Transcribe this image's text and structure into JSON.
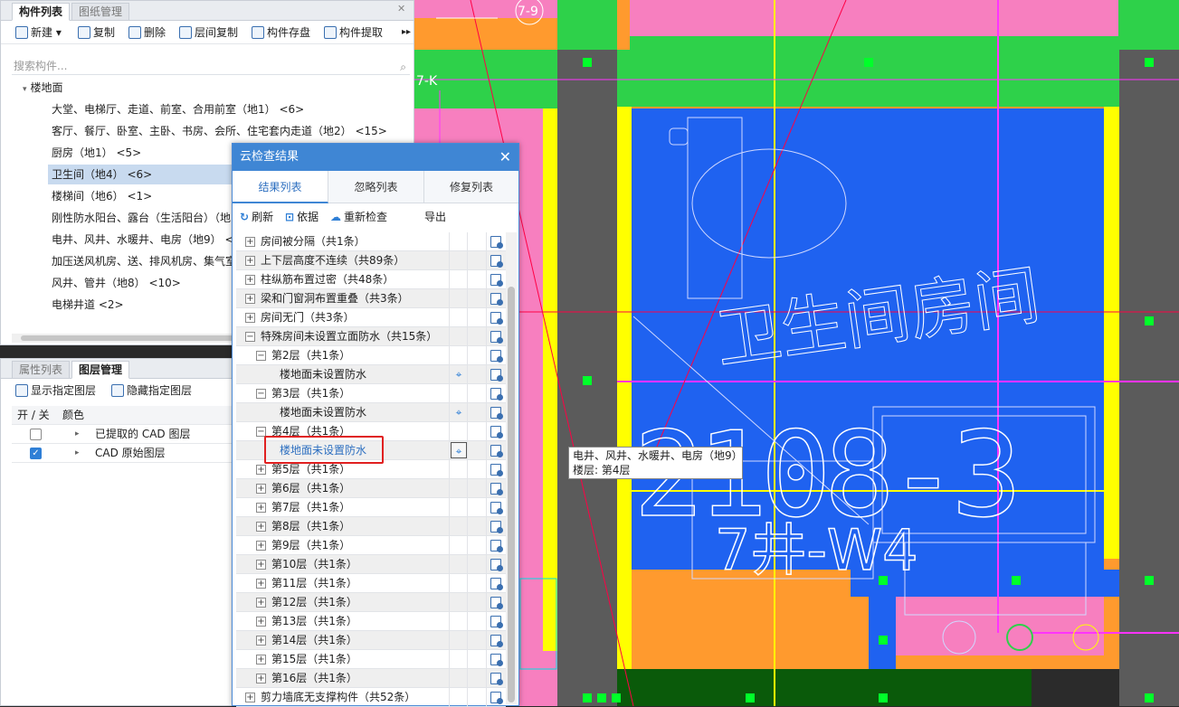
{
  "colors": {
    "pink": "#f77fbf",
    "green": "#2ed14a",
    "blue": "#1f62f0",
    "orange": "#ff9a2e",
    "yellow": "#ffff00",
    "gray": "#5b5b5b",
    "dark_green": "#0a5a0a",
    "magenta": "#ff33ff",
    "accent": "#3f86d4"
  },
  "cad": {
    "labels": {
      "grid_a": "7-9",
      "grid_b": "7-K",
      "room_name": "卫生间房间",
      "code": "2108-3",
      "code2": "7井-W4"
    }
  },
  "component_panel": {
    "tabs": [
      "构件列表",
      "图纸管理"
    ],
    "toolbar": [
      {
        "label": "新建",
        "icon": "new-icon"
      },
      {
        "label": "复制",
        "icon": "copy-icon"
      },
      {
        "label": "删除",
        "icon": "delete-icon"
      },
      {
        "label": "层间复制",
        "icon": "floor-copy-icon"
      },
      {
        "label": "构件存盘",
        "icon": "save-component-icon"
      },
      {
        "label": "构件提取",
        "icon": "extract-component-icon"
      }
    ],
    "search_placeholder": "搜索构件...",
    "tree_root": "楼地面",
    "tree_items": [
      "大堂、电梯厅、走道、前室、合用前室（地1）  <6>",
      "客厅、餐厅、卧室、主卧、书房、会所、住宅套内走道（地2）  <15>",
      "厨房（地1）  <5>",
      "卫生间（地4）  <6>",
      "楼梯间（地6）  <1>",
      "刚性防水阳台、露台（生活阳台）（地",
      "电井、风井、水暖井、电房（地9）  <",
      "加压送风机房、送、排风机房、集气室",
      "风井、管井（地8）  <10>",
      "电梯井道  <2>"
    ],
    "selected_index": 3
  },
  "layer_panel": {
    "tabs": [
      "属性列表",
      "图层管理"
    ],
    "show_label": "显示指定图层",
    "hide_label": "隐藏指定图层",
    "col_onoff": "开 / 关",
    "col_color": "颜色",
    "layers": [
      {
        "name": "已提取的 CAD 图层",
        "on": false
      },
      {
        "name": "CAD 原始图层",
        "on": true
      }
    ]
  },
  "dialog": {
    "title": "云检查结果",
    "tabs": [
      "结果列表",
      "忽略列表",
      "修复列表"
    ],
    "toolbar": {
      "refresh": "刷新",
      "basis": "依据",
      "recheck": "重新检查",
      "export": "导出"
    },
    "rows": [
      {
        "text": "房间被分隔（共1条）",
        "level": 0,
        "expand": "+"
      },
      {
        "text": "上下层高度不连续（共89条）",
        "level": 0,
        "expand": "+"
      },
      {
        "text": "柱纵筋布置过密（共48条）",
        "level": 0,
        "expand": "+"
      },
      {
        "text": "梁和门窗洞布置重叠（共3条）",
        "level": 0,
        "expand": "+"
      },
      {
        "text": "房间无门（共3条）",
        "level": 0,
        "expand": "+"
      },
      {
        "text": "特殊房间未设置立面防水（共15条）",
        "level": 0,
        "expand": "-"
      },
      {
        "text": "第2层（共1条）",
        "level": 1,
        "expand": "-"
      },
      {
        "text": "楼地面未设置防水",
        "level": 2,
        "expand": ""
      },
      {
        "text": "第3层（共1条）",
        "level": 1,
        "expand": "-"
      },
      {
        "text": "楼地面未设置防水",
        "level": 2,
        "expand": ""
      },
      {
        "text": "第4层（共1条）",
        "level": 1,
        "expand": "-"
      },
      {
        "text": "楼地面未设置防水",
        "level": 2,
        "expand": "",
        "highlight": true
      },
      {
        "text": "第5层（共1条）",
        "level": 1,
        "expand": "+"
      },
      {
        "text": "第6层（共1条）",
        "level": 1,
        "expand": "+"
      },
      {
        "text": "第7层（共1条）",
        "level": 1,
        "expand": "+"
      },
      {
        "text": "第8层（共1条）",
        "level": 1,
        "expand": "+"
      },
      {
        "text": "第9层（共1条）",
        "level": 1,
        "expand": "+"
      },
      {
        "text": "第10层（共1条）",
        "level": 1,
        "expand": "+"
      },
      {
        "text": "第11层（共1条）",
        "level": 1,
        "expand": "+"
      },
      {
        "text": "第12层（共1条）",
        "level": 1,
        "expand": "+"
      },
      {
        "text": "第13层（共1条）",
        "level": 1,
        "expand": "+"
      },
      {
        "text": "第14层（共1条）",
        "level": 1,
        "expand": "+"
      },
      {
        "text": "第15层（共1条）",
        "level": 1,
        "expand": "+"
      },
      {
        "text": "第16层（共1条）",
        "level": 1,
        "expand": "+"
      },
      {
        "text": "剪力墙底无支撑构件（共52条）",
        "level": 0,
        "expand": "+"
      }
    ]
  },
  "tooltip": {
    "line1": "电井、风井、水暖井、电房（地9）",
    "line2": "楼层: 第4层"
  }
}
